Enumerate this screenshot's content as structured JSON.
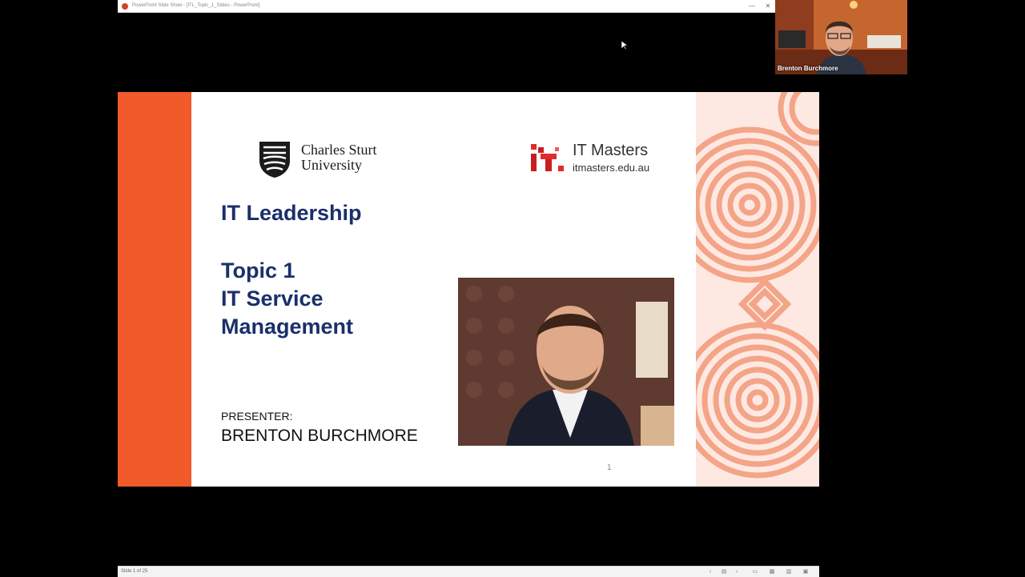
{
  "window": {
    "title": "PowerPoint Slide Show - [ITL_Topic_1_Slides - PowerPoint]",
    "controls": {
      "minimize": "—",
      "close": "✕"
    }
  },
  "slide": {
    "csu_logo_text_line1": "Charles Sturt",
    "csu_logo_text_line2": "University",
    "itm_title": "IT Masters",
    "itm_url": "itmasters.edu.au",
    "title": "IT Leadership",
    "topic_line1": "Topic 1",
    "topic_line2": "IT Service",
    "topic_line3": "Management",
    "presenter_label": "PRESENTER:",
    "presenter_name": "BRENTON BURCHMORE",
    "slide_number": "1",
    "colors": {
      "accent": "#f15a29",
      "title": "#1a2f6b",
      "pattern": "#f4a488"
    }
  },
  "statusbar": {
    "slide_count": "Slide 1 of 25",
    "icons": [
      "prev-icon",
      "slide-menu-icon",
      "next-icon",
      "normal-view-icon",
      "slide-sorter-icon",
      "reading-view-icon",
      "slideshow-icon"
    ]
  },
  "video": {
    "participant_name": "Brenton Burchmore"
  }
}
